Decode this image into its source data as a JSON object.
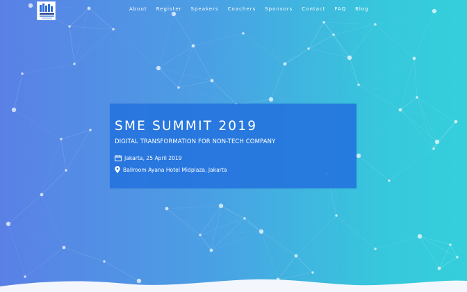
{
  "logo": {
    "name": "sme-summit-logo"
  },
  "nav": {
    "items": [
      {
        "label": "About"
      },
      {
        "label": "Register"
      },
      {
        "label": "Speakers"
      },
      {
        "label": "Coachers"
      },
      {
        "label": "Sponsors"
      },
      {
        "label": "Contact"
      },
      {
        "label": "FAQ"
      },
      {
        "label": "Blog"
      }
    ]
  },
  "hero": {
    "title": "SME SUMMIT 2019",
    "subtitle": "DIGITAL TRANSFORMATION FOR NON-TECH COMPANY",
    "date": "Jakarta, 25 April 2019",
    "venue": "Ballroom Ayana Hotel Midplaza, Jakarta",
    "date_icon": "calendar-icon",
    "venue_icon": "map-pin-icon"
  },
  "colors": {
    "gradient_left": "#5a80e6",
    "gradient_right": "#34cfdc",
    "hero_box": "#2573de",
    "text": "#ffffff"
  }
}
